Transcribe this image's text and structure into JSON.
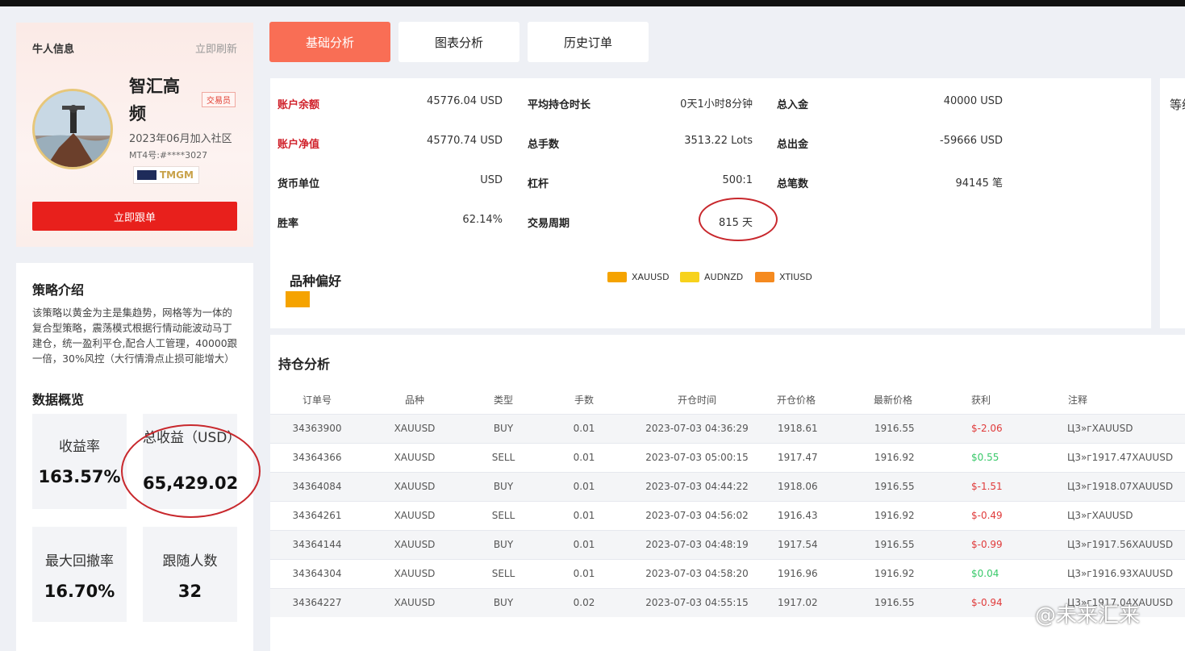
{
  "profile": {
    "header_title": "牛人信息",
    "refresh": "立即刷新",
    "name": "智汇高频",
    "role_badge": "交易员",
    "join_date": "2023年06月加入社区",
    "mt4": "MT4号:#****3027",
    "broker": "TMGM",
    "follow_button": "立即跟单"
  },
  "strategy": {
    "title": "策略介绍",
    "description": "该策略以黄金为主是集趋势，网格等为一体的复合型策略，震荡模式根据行情动能波动马丁建仓，统一盈利平仓,配合人工管理，40000跟一倍，30%风控（大行情滑点止损可能增大）"
  },
  "overview": {
    "title": "数据概览",
    "stats": [
      {
        "label": "收益率",
        "value": "163.57%"
      },
      {
        "label": "总收益（USD）",
        "value": "65,429.02"
      },
      {
        "label": "最大回撤率",
        "value": "16.70%"
      },
      {
        "label": "跟随人数",
        "value": "32"
      }
    ]
  },
  "tabs": [
    "基础分析",
    "图表分析",
    "历史订单"
  ],
  "basic": {
    "col1": [
      {
        "label": "账户余额",
        "value": "45776.04 USD",
        "accent": true
      },
      {
        "label": "账户净值",
        "value": "45770.74 USD",
        "accent": true
      },
      {
        "label": "货币单位",
        "value": "USD",
        "accent": false
      },
      {
        "label": "胜率",
        "value": "62.14%",
        "accent": false
      }
    ],
    "col2": [
      {
        "label": "平均持仓时长",
        "value": "0天1小时8分钟"
      },
      {
        "label": "总手数",
        "value": "3513.22 Lots"
      },
      {
        "label": "杠杆",
        "value": "500:1"
      },
      {
        "label": "交易周期",
        "value": "815 天"
      }
    ],
    "col3": [
      {
        "label": "总入金",
        "value": "40000 USD"
      },
      {
        "label": "总出金",
        "value": "-59666 USD"
      },
      {
        "label": "总笔数",
        "value": "94145 笔"
      }
    ],
    "side_label": "等级",
    "preference_title": "品种偏好",
    "preference_legend": [
      {
        "name": "XAUUSD",
        "color": "#f5a300"
      },
      {
        "name": "AUDNZD",
        "color": "#f7d21c"
      },
      {
        "name": "XTIUSD",
        "color": "#f58a1f"
      }
    ]
  },
  "positions": {
    "title": "持仓分析",
    "columns": [
      "订单号",
      "品种",
      "类型",
      "手数",
      "开仓时间",
      "开仓价格",
      "最新价格",
      "获利",
      "注释"
    ],
    "rows": [
      [
        "34363900",
        "XAUUSD",
        "BUY",
        "0.01",
        "2023-07-03 04:36:29",
        "1918.61",
        "1916.55",
        "$-2.06",
        "Ц3»гXAUUSD"
      ],
      [
        "34364366",
        "XAUUSD",
        "SELL",
        "0.01",
        "2023-07-03 05:00:15",
        "1917.47",
        "1916.92",
        "$0.55",
        "Ц3»г1917.47XAUUSD"
      ],
      [
        "34364084",
        "XAUUSD",
        "BUY",
        "0.01",
        "2023-07-03 04:44:22",
        "1918.06",
        "1916.55",
        "$-1.51",
        "Ц3»г1918.07XAUUSD"
      ],
      [
        "34364261",
        "XAUUSD",
        "SELL",
        "0.01",
        "2023-07-03 04:56:02",
        "1916.43",
        "1916.92",
        "$-0.49",
        "Ц3»гXAUUSD"
      ],
      [
        "34364144",
        "XAUUSD",
        "BUY",
        "0.01",
        "2023-07-03 04:48:19",
        "1917.54",
        "1916.55",
        "$-0.99",
        "Ц3»г1917.56XAUUSD"
      ],
      [
        "34364304",
        "XAUUSD",
        "SELL",
        "0.01",
        "2023-07-03 04:58:20",
        "1916.96",
        "1916.92",
        "$0.04",
        "Ц3»г1916.93XAUUSD"
      ],
      [
        "34364227",
        "XAUUSD",
        "BUY",
        "0.02",
        "2023-07-03 04:55:15",
        "1917.02",
        "1916.55",
        "$-0.94",
        "Ц3»г1917.04XAUUSD"
      ]
    ]
  },
  "watermark": "@未来汇来",
  "colors": {
    "accent": "#f96e55",
    "button_red": "#e8201c",
    "loss": "#e03b3b",
    "gain": "#39c96a"
  }
}
